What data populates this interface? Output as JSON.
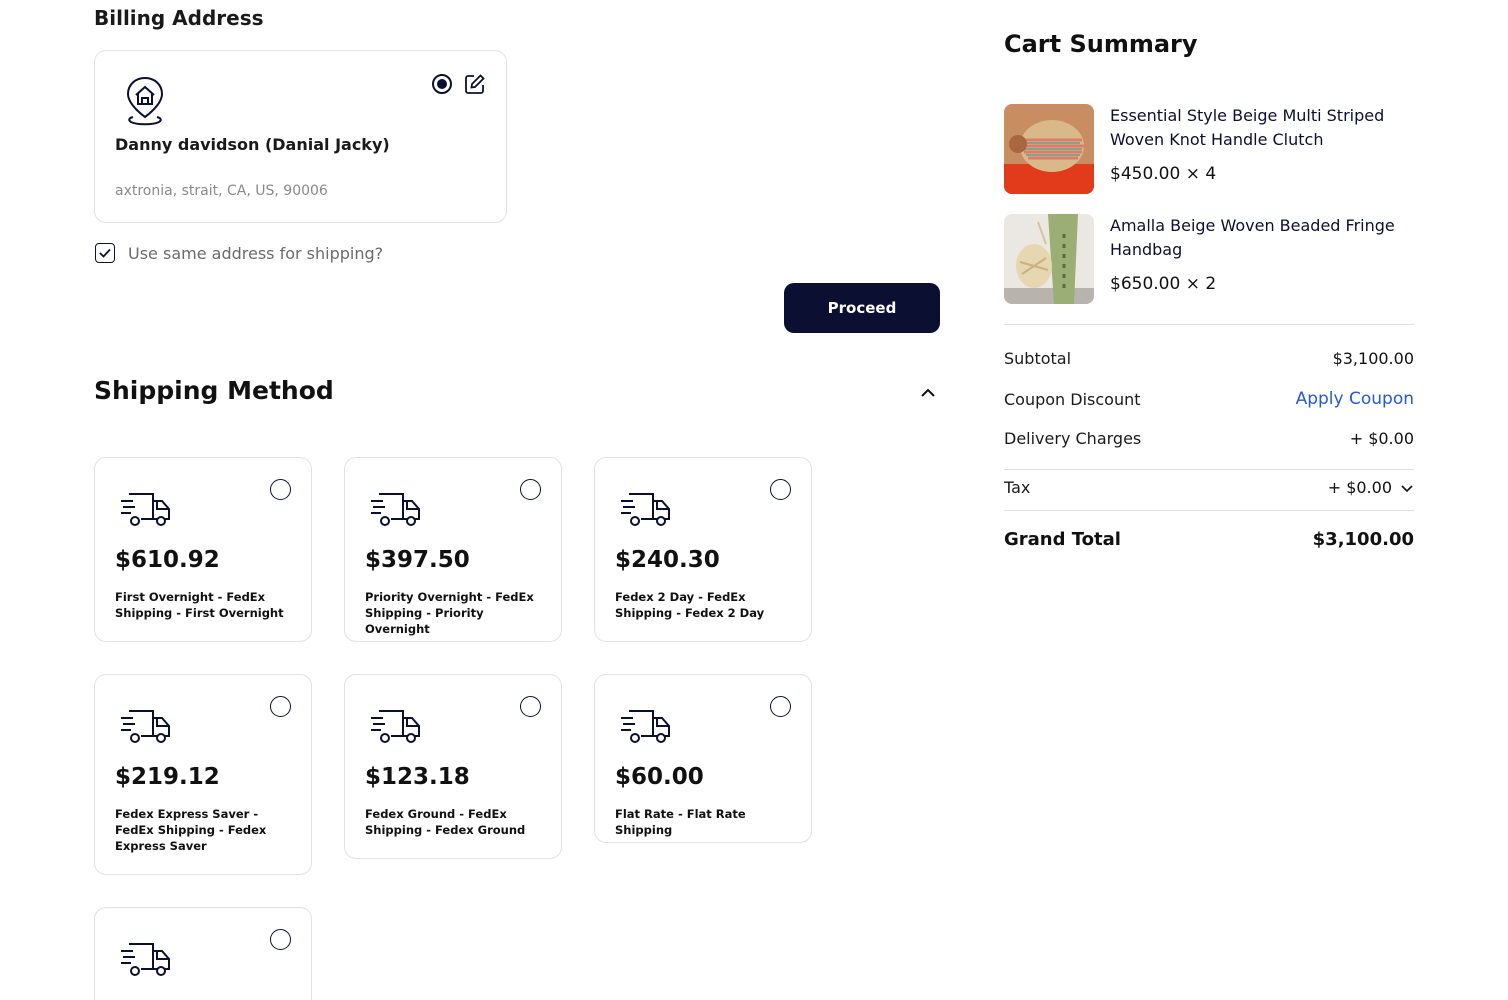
{
  "billing": {
    "title": "Billing Address",
    "name": "Danny davidson (Danial Jacky)",
    "address": "axtronia, strait, CA, US, 90006",
    "same_address_label": "Use same address for shipping?"
  },
  "proceed_label": "Proceed",
  "shipping": {
    "title": "Shipping Method",
    "options": [
      {
        "price": "$610.92",
        "desc": "First Overnight - FedEx Shipping - First Overnight"
      },
      {
        "price": "$397.50",
        "desc": "Priority Overnight - FedEx Shipping - Priority Overnight"
      },
      {
        "price": "$240.30",
        "desc": "Fedex 2 Day - FedEx Shipping - Fedex 2 Day"
      },
      {
        "price": "$219.12",
        "desc": "Fedex Express Saver - FedEx Shipping - Fedex Express Saver"
      },
      {
        "price": "$123.18",
        "desc": "Fedex Ground - FedEx Shipping - Fedex Ground"
      },
      {
        "price": "$60.00",
        "desc": "Flat Rate - Flat Rate Shipping"
      },
      {
        "price": "",
        "desc": ""
      }
    ]
  },
  "cart": {
    "title": "Cart Summary",
    "items": [
      {
        "name": "Essential Style Beige Multi Striped Woven Knot Handle Clutch",
        "price": "$450.00 × 4"
      },
      {
        "name": "Amalla Beige Woven Beaded Fringe Handbag",
        "price": "$650.00 × 2"
      }
    ],
    "subtotal_label": "Subtotal",
    "subtotal_value": "$3,100.00",
    "coupon_label": "Coupon Discount",
    "coupon_link": "Apply Coupon",
    "delivery_label": "Delivery Charges",
    "delivery_value": "+ $0.00",
    "tax_label": "Tax",
    "tax_value": "+ $0.00",
    "grand_label": "Grand Total",
    "grand_value": "$3,100.00"
  },
  "colors": {
    "primary": "#0b1033",
    "link": "#2659d6",
    "border": "#e2e2e2"
  }
}
